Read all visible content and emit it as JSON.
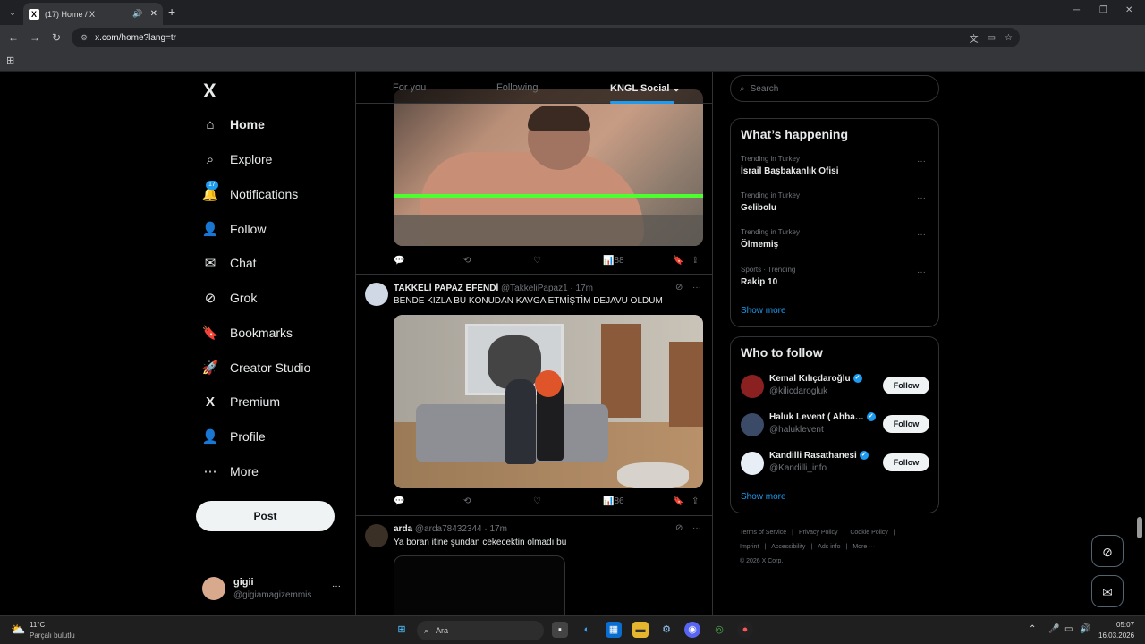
{
  "browser": {
    "tab_title": "(17) Home / X",
    "tab_logo": "X",
    "url": "x.com/home?lang=tr",
    "new_tab": "+",
    "win_min": "─",
    "win_max": "❐",
    "win_close": "✕"
  },
  "sidebar": {
    "logo": "X",
    "items": [
      {
        "label": "Home",
        "icon": "home-icon",
        "glyph": "⌂"
      },
      {
        "label": "Explore",
        "icon": "search-icon",
        "glyph": "⌕"
      },
      {
        "label": "Notifications",
        "icon": "bell-icon",
        "glyph": "🔔",
        "badge": "17"
      },
      {
        "label": "Follow",
        "icon": "person-add-icon",
        "glyph": "👤"
      },
      {
        "label": "Chat",
        "icon": "mail-icon",
        "glyph": "✉"
      },
      {
        "label": "Grok",
        "icon": "grok-icon",
        "glyph": "⊘"
      },
      {
        "label": "Bookmarks",
        "icon": "bookmark-icon",
        "glyph": "🔖"
      },
      {
        "label": "Creator Studio",
        "icon": "rocket-icon",
        "glyph": "🚀"
      },
      {
        "label": "Premium",
        "icon": "x-premium-icon",
        "glyph": "X"
      },
      {
        "label": "Profile",
        "icon": "profile-icon",
        "glyph": "👤"
      },
      {
        "label": "More",
        "icon": "more-circle-icon",
        "glyph": "⋯"
      }
    ],
    "post_label": "Post",
    "account": {
      "name": "gigii",
      "handle": "@gigiamagizemmis",
      "dots": "···"
    }
  },
  "feed": {
    "tabs": [
      "For you",
      "Following",
      "KNGL Social"
    ],
    "tab_chevron": "⌄",
    "post1_actions": {
      "views": "88"
    },
    "post2": {
      "name": "TAKKELİ PAPAZ EFENDİ",
      "handle": "@TakkeliPapaz1",
      "time": "17m",
      "text": "BENDE KIZLA BU KONUDAN KAVGA ETMİŞTİM DEJAVU OLDUM",
      "views": "86"
    },
    "post3": {
      "name": "arda",
      "handle": "@arda78432344",
      "time": "17m",
      "text": "Ya boran itine şundan cekecektin olmadı bu"
    },
    "sep": " · "
  },
  "right": {
    "search_placeholder": "Search",
    "trends_title": "What’s happening",
    "trends": [
      {
        "meta": "Trending in Turkey",
        "name": "İsrail Başbakanlık Ofisi"
      },
      {
        "meta": "Trending in Turkey",
        "name": "Gelibolu"
      },
      {
        "meta": "Trending in Turkey",
        "name": "Ölmemiş"
      },
      {
        "meta": "Sports · Trending",
        "name": "Rakip 10"
      }
    ],
    "show_more": "Show more",
    "wtf_title": "Who to follow",
    "wtf": [
      {
        "name": "Kemal Kılıçdaroğlu",
        "handle": "@kilicdarogluk",
        "follow": "Follow"
      },
      {
        "name": "Haluk Levent ( Ahba…",
        "handle": "@haluklevent",
        "follow": "Follow"
      },
      {
        "name": "Kandilli Rasathanesi",
        "handle": "@Kandilli_info",
        "follow": "Follow"
      }
    ],
    "footer": [
      "Terms of Service",
      "|",
      "Privacy Policy",
      "|",
      "Cookie Policy",
      "|",
      "Imprint",
      "|",
      "Accessibility",
      "|",
      "Ads info",
      "|",
      "More ···",
      "© 2026 X Corp."
    ]
  },
  "taskbar": {
    "temp": "11°C",
    "weather": "Parçalı bulutlu",
    "search": "Ara",
    "time": "05:07",
    "date": "16.03.2026"
  },
  "colors": {
    "accent": "#1d9bf0",
    "background": "#000000",
    "text": "#e7e9ea",
    "muted": "#71767b"
  }
}
